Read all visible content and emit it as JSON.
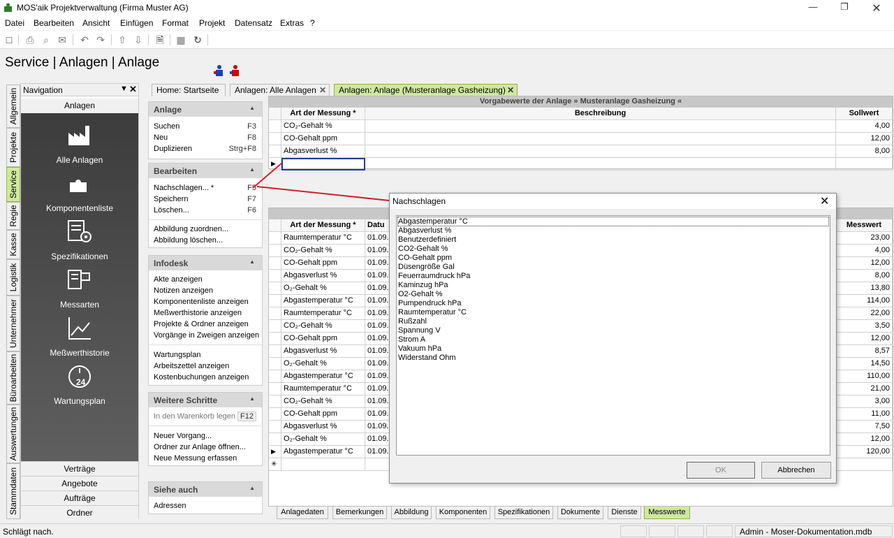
{
  "window": {
    "title": "MOS'aik Projektverwaltung (Firma Muster AG)"
  },
  "menu": [
    "Datei",
    "Bearbeiten",
    "Ansicht",
    "Einfügen",
    "Format",
    "Projekt",
    "Datensatz",
    "Extras",
    "?"
  ],
  "page_title": "Service | Anlagen | Anlage",
  "vertical_tabs": [
    "Allgemein",
    "Projekte",
    "Service",
    "Regie",
    "Kasse",
    "Logistik",
    "Unternehmer",
    "Büroarbeiten",
    "Auswertungen",
    "Stammdaten"
  ],
  "nav": {
    "title": "Navigation",
    "section": "Anlagen",
    "items": [
      "Alle Anlagen",
      "Komponentenliste",
      "Spezifikationen",
      "Messarten",
      "Meßwerthistorie",
      "Wartungsplan"
    ],
    "bottom": [
      "Verträge",
      "Angebote",
      "Aufträge",
      "Ordner"
    ]
  },
  "doc_tabs": [
    "Home: Startseite",
    "Anlagen: Alle Anlagen",
    "Anlagen: Anlage (Musteranlage Gasheizung)"
  ],
  "panels": {
    "anlage": {
      "title": "Anlage",
      "items": [
        {
          "label": "Suchen",
          "key": "F3"
        },
        {
          "label": "Neu",
          "key": "F8"
        },
        {
          "label": "Duplizieren",
          "key": "Strg+F8"
        }
      ]
    },
    "bearbeiten": {
      "title": "Bearbeiten",
      "items": [
        {
          "label": "Nachschlagen... *",
          "key": "F5"
        },
        {
          "label": "Speichern",
          "key": "F7"
        },
        {
          "label": "Löschen...",
          "key": "F6"
        },
        {
          "label": "Abbildung zuordnen...",
          "key": ""
        },
        {
          "label": "Abbildung löschen...",
          "key": ""
        }
      ]
    },
    "infodesk": {
      "title": "Infodesk",
      "items": [
        "Akte anzeigen",
        "Notizen anzeigen",
        "Komponentenliste anzeigen",
        "Meßwerthistorie anzeigen",
        "Projekte & Ordner anzeigen",
        "Vorgänge in Zweigen anzeigen",
        "Wartungsplan",
        "Arbeitszettel anzeigen",
        "Kostenbuchungen anzeigen"
      ]
    },
    "weitere": {
      "title": "Weitere Schritte",
      "items": [
        {
          "label": "In den Warenkorb legen",
          "key": "F12"
        },
        {
          "label": "Neuer Vorgang...",
          "key": ""
        },
        {
          "label": "Ordner zur Anlage öffnen...",
          "key": ""
        },
        {
          "label": "Neue Messung erfassen",
          "key": ""
        }
      ]
    },
    "siehe": {
      "title": "Siehe auch",
      "items": [
        "Adressen"
      ]
    }
  },
  "grid1": {
    "caption": "Vorgabewerte der Anlage » Musteranlage Gasheizung «",
    "headers": [
      "Art der Messung *",
      "Beschreibung",
      "Sollwert"
    ],
    "rows": [
      [
        "CO₂-Gehalt %",
        "",
        "4,00"
      ],
      [
        "CO-Gehalt ppm",
        "",
        "12,00"
      ],
      [
        "Abgasverlust %",
        "",
        "8,00"
      ]
    ]
  },
  "grid2": {
    "headers": [
      "Art der Messung *",
      "Datu",
      "Messwert"
    ],
    "rows": [
      [
        "Raumtemperatur °C",
        "01.09.",
        "23,00"
      ],
      [
        "CO₂-Gehalt %",
        "01.09.",
        "4,00"
      ],
      [
        "CO-Gehalt ppm",
        "01.09.",
        "12,00"
      ],
      [
        "Abgasverlust %",
        "01.09.",
        "8,00"
      ],
      [
        "O₂-Gehalt %",
        "01.09.",
        "13,80"
      ],
      [
        "Abgastemperatur °C",
        "01.09.",
        "114,00"
      ],
      [
        "Raumtemperatur °C",
        "01.09.",
        "22,00"
      ],
      [
        "CO₂-Gehalt %",
        "01.09.",
        "3,50"
      ],
      [
        "CO-Gehalt ppm",
        "01.09.",
        "12,00"
      ],
      [
        "Abgasverlust %",
        "01.09.",
        "8,57"
      ],
      [
        "O₂-Gehalt %",
        "01.09.",
        "14,50"
      ],
      [
        "Abgastemperatur °C",
        "01.09.",
        "110,00"
      ],
      [
        "Raumtemperatur °C",
        "01.09.",
        "21,00"
      ],
      [
        "CO₂-Gehalt %",
        "01.09.",
        "3,00"
      ],
      [
        "CO-Gehalt ppm",
        "01.09.",
        "11,00"
      ],
      [
        "Abgasverlust %",
        "01.09.",
        "7,50"
      ],
      [
        "O₂-Gehalt %",
        "01.09.",
        "12,00"
      ],
      [
        "Abgastemperatur °C",
        "01.09.",
        "120,00"
      ]
    ]
  },
  "dialog": {
    "title": "Nachschlagen",
    "items": [
      "Abgastemperatur °C",
      "Abgasverlust %",
      "Benutzerdefiniert",
      "CO2-Gehalt %",
      "CO-Gehalt ppm",
      "Düsengröße Gal",
      "Feuerraumdruck hPa",
      "Kaminzug hPa",
      "O2-Gehalt %",
      "Pumpendruck hPa",
      "Raumtemperatur °C",
      "Rußzahl",
      "Spannung V",
      "Strom A",
      "Vakuum hPa",
      "Widerstand Ohm"
    ],
    "ok": "OK",
    "cancel": "Abbrechen"
  },
  "bottom_tabs": [
    "Anlagedaten",
    "Bemerkungen",
    "Abbildung",
    "Komponenten",
    "Spezifikationen",
    "Dokumente",
    "Dienste",
    "Messwerte"
  ],
  "status": {
    "text": "Schlägt nach.",
    "right": "Admin - Moser-Dokumentation.mdb"
  },
  "colors": {
    "active_tab": "#cfe8a0",
    "nav_dark": "#4a4a4a",
    "connector": "#d0202a"
  }
}
